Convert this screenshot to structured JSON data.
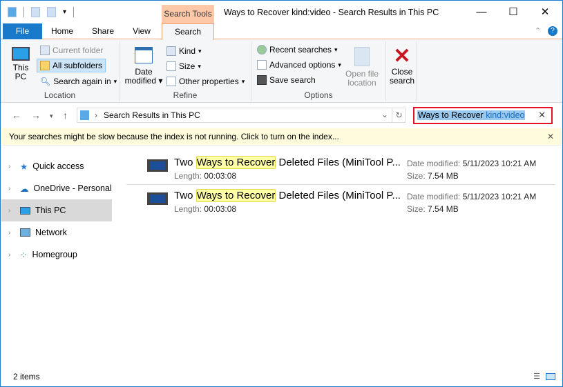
{
  "window": {
    "title": "Ways to Recover kind:video - Search Results in This PC",
    "context_tab": "Search Tools",
    "minimize": "—",
    "maximize": "☐",
    "close": "✕"
  },
  "tabs": [
    {
      "label": "File"
    },
    {
      "label": "Home"
    },
    {
      "label": "Share"
    },
    {
      "label": "View"
    },
    {
      "label": "Search"
    }
  ],
  "ribbon": {
    "location": {
      "label": "Location",
      "this_pc_1": "This",
      "this_pc_2": "PC",
      "current_folder": "Current folder",
      "all_subfolders": "All subfolders",
      "search_again": "Search again in"
    },
    "refine": {
      "label": "Refine",
      "date_1": "Date",
      "date_2": "modified",
      "kind": "Kind",
      "size": "Size",
      "other": "Other properties"
    },
    "options": {
      "label": "Options",
      "recent": "Recent searches",
      "advanced": "Advanced options",
      "save": "Save search",
      "open_1": "Open file",
      "open_2": "location"
    },
    "close": {
      "l1": "Close",
      "l2": "search"
    }
  },
  "address": {
    "path": "Search Results in This PC",
    "search_term": "Ways to Recover",
    "search_kind": "kind:video"
  },
  "info_bar": "Your searches might be slow because the index is not running.  Click to turn on the index...",
  "sidebar": [
    {
      "label": "Quick access"
    },
    {
      "label": "OneDrive - Personal"
    },
    {
      "label": "This PC"
    },
    {
      "label": "Network"
    },
    {
      "label": "Homegroup"
    }
  ],
  "results": [
    {
      "pre": "Two ",
      "match": "Ways to Recover",
      "post": " Deleted Files (MiniTool P...",
      "length_label": "Length:",
      "length": "00:03:08",
      "date_label": "Date modified:",
      "date": "5/11/2023 10:21 AM",
      "size_label": "Size:",
      "size": "7.54 MB"
    },
    {
      "pre": "Two ",
      "match": "Ways to Recover",
      "post": " Deleted Files (MiniTool P...",
      "length_label": "Length:",
      "length": "00:03:08",
      "date_label": "Date modified:",
      "date": "5/11/2023 10:21 AM",
      "size_label": "Size:",
      "size": "7.54 MB"
    }
  ],
  "status": "2 items",
  "colors": {
    "accent": "#1979ca",
    "context": "#fcc8a8",
    "highlight": "#ffffa8",
    "search_border": "#e81123"
  }
}
